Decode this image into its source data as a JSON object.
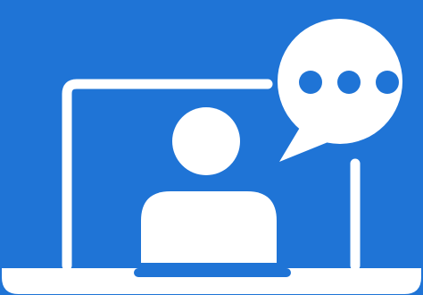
{
  "colors": {
    "background": "#1f74d6",
    "foreground": "#ffffff",
    "accent": "#1f74d6"
  },
  "icons": {
    "laptop": "laptop-icon",
    "person": "person-icon",
    "speech_bubble": "speech-bubble-icon",
    "ellipsis": "ellipsis-icon"
  }
}
